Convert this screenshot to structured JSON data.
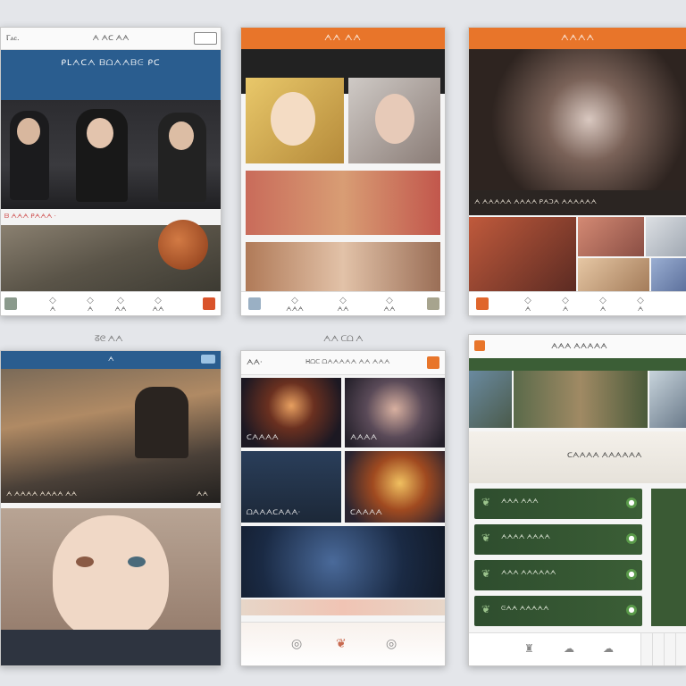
{
  "captions": {
    "bottom_left": "ᘔᘓ ᗅᗅ",
    "bottom_center": "ᗅᗅ ᑕᗝ ᗅ"
  },
  "s1": {
    "status_left": "Ⲅⲁⲥ.",
    "status_center": "ᗅ ᗅᑕ ᗅᗅ",
    "banner": "ᑭⅬᗅᑕᗅ ᗷᗝᗅᗅᗷᕮ ᑭᑕ",
    "section": "ᗷ ᗅᗅᗅ ᑭᗅᗅᗅ ·",
    "tabs": [
      "ᗅ",
      "ᗅ",
      "ᗅᗅ",
      "ᗅᗅ"
    ]
  },
  "s2": {
    "status_center": "ᗅᗅ ᗅᗅ",
    "tabs": [
      "ᗅᗅᗅ",
      "ᗅᗅ",
      "ᗅᗅ"
    ]
  },
  "s3": {
    "title": "ᗅᗅᗅᗅ",
    "caption": "ᗅ ᗅᗅᗅᗅᗅ ᗅᗅᗅᗅ ᑭᗅᑐᗅ ᗅᗅᗅᗅᗅᗅ",
    "tabs": [
      "ᗅ",
      "ᗅ",
      "ᗅ",
      "ᗅ"
    ]
  },
  "s4": {
    "status_left": "ᗅ",
    "caption": "ᗅ ᗅᗅᗅᗅ ᗅᗅᗅᗅ ᗅᗅ",
    "caption_right": "ᗅᗅ"
  },
  "s5": {
    "title": "ᗅᗅ·",
    "subtitle": "ᕼᗝᑕ ᗝᗅᗅᗅᗅᗅ ᗅᗅ ᗅᗅᗅ",
    "tiles": [
      "ᑕᗅᗅᗅᗅ",
      "ᗅᗅᗅᗅ",
      "ᗝᗅᗅᗅᑕᗅᗅᗅ·",
      "ᑕᗅᗅᗅᗅ"
    ]
  },
  "s6": {
    "title": "ᗅᗅᗅ ᗅᗅᗅᗅᗅ",
    "section": "ᑕᗅᗅᗅᗅ ᗅᗅᗅᗅᗅᗅ",
    "rows": [
      "ᗅᗅᗅ ᗅᗅᗅ",
      "ᗅᗅᗅᗅ ᗅᗅᗅᗅ",
      "ᗅᗅᗅ ᗅᗅᗅᗅᗅᗅ",
      "ᕮᗅᗅ ᗅᗅᗅᗅᗅ"
    ]
  },
  "colors": {
    "blue": "#2a5d8f",
    "orange": "#e8752a",
    "green": "#3b5e36"
  }
}
